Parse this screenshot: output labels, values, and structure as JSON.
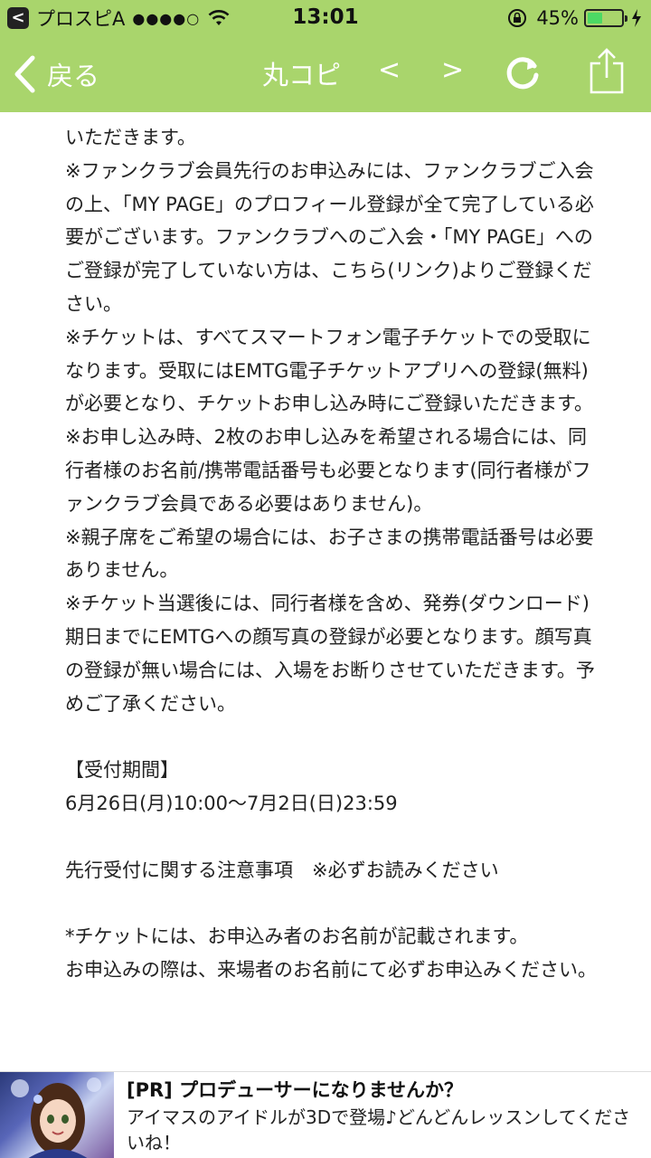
{
  "status_bar": {
    "back_app_label": "<",
    "carrier": "プロスピA",
    "signal": "●●●●○",
    "time": "13:01",
    "battery_percent": "45%",
    "battery_level": 0.45
  },
  "nav": {
    "back_label": "戻る",
    "title": "丸コピ",
    "prev": "<",
    "next": ">"
  },
  "content": {
    "block1": "いただきます。\n※ファンクラブ会員先行のお申込みには、ファンクラブご入会の上、「MY PAGE」のプロフィール登録が全て完了している必要がございます。ファンクラブへのご入会・「MY PAGE」へのご登録が完了していない方は、こちら(リンク)よりご登録ください。\n※チケットは、すべてスマートフォン電子チケットでの受取になります。受取にはEMTG電子チケットアプリへの登録(無料)が必要となり、チケットお申し込み時にご登録いただきます。\n※お申し込み時、2枚のお申し込みを希望される場合には、同行者様のお名前/携帯電話番号も必要となります(同行者様がファンクラブ会員である必要はありません)。\n※親子席をご希望の場合には、お子さまの携帯電話番号は必要ありません。\n※チケット当選後には、同行者様を含め、発券(ダウンロード)期日までにEMTGへの顔写真の登録が必要となります。顔写真の登録が無い場合には、入場をお断りさせていただきます。予めご了承ください。",
    "period_heading": "【受付期間】",
    "period_value": "6月26日(月)10:00〜7月2日(日)23:59",
    "notes_heading": "先行受付に関する注意事項　※必ずお読みください",
    "notes_body": "*チケットには、お申込み者のお名前が記載されます。\nお申込みの際は、来場者のお名前にて必ずお申込みください。"
  },
  "ad": {
    "title": "[PR] プロデューサーになりませんか？",
    "body": "アイマスのアイドルが3Dで登場♪どんどんレッスンしてくださいね！"
  },
  "colors": {
    "bar_green": "#a9d56c",
    "battery_green": "#4cd964"
  }
}
